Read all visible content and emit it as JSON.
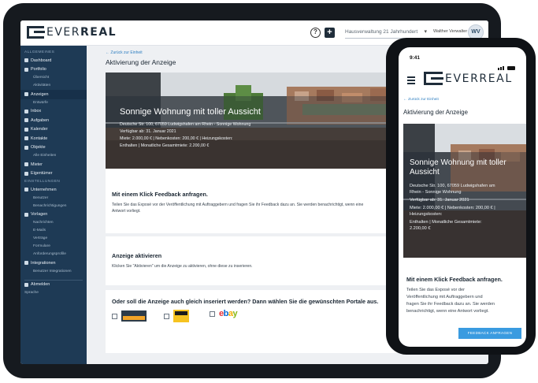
{
  "brand": {
    "name": "EVERREAL",
    "name_light": "EVER",
    "name_bold": "REAL"
  },
  "topbar": {
    "select_value": "Hausverwaltung 21 Jahrhundert",
    "user_name": "Walther Verwalter",
    "avatar_initials": "WV"
  },
  "sidebar": {
    "sections": [
      {
        "heading": "ALLGEMEINES",
        "items": [
          {
            "label": "Dashboard",
            "icon": "grid-icon"
          },
          {
            "label": "Portfolio",
            "icon": "pin-icon",
            "subitems": [
              "Übersicht",
              "Aktivitäten"
            ]
          },
          {
            "label": "Anzeigen",
            "icon": "list-icon",
            "subitems": [
              "Entwürfe"
            ]
          },
          {
            "label": "Inbox",
            "icon": "inbox-icon"
          },
          {
            "label": "Aufgaben",
            "icon": "task-icon"
          },
          {
            "label": "Kalender",
            "icon": "calendar-icon"
          },
          {
            "label": "Kontakte",
            "icon": "contacts-icon"
          },
          {
            "label": "Objekte",
            "icon": "objects-icon",
            "subitems": [
              "Alle Einheiten"
            ]
          },
          {
            "label": "Mieter",
            "icon": "tenant-icon"
          },
          {
            "label": "Eigentümer",
            "icon": "owner-icon"
          }
        ]
      },
      {
        "heading": "EINSTELLUNGEN",
        "items": [
          {
            "label": "Unternehmen",
            "icon": "company-icon",
            "subitems": [
              "Benutzer",
              "Benachrichtigungen"
            ]
          },
          {
            "label": "Vorlagen",
            "icon": "template-icon",
            "subitems": [
              "Nachrichten",
              "E-Mails",
              "Verträge",
              "Formulare",
              "Anforderungsprofile"
            ]
          },
          {
            "label": "Integrationen",
            "icon": "integration-icon",
            "subitems": [
              "Benutzer Integrationen"
            ]
          }
        ]
      }
    ],
    "logout_label": "Abmelden",
    "language_label": "Sprache"
  },
  "main": {
    "back_label": "Zurück zur Einheit",
    "title": "Aktivierung der Anzeige",
    "hero": {
      "title": "Sonnige Wohnung mit toller Aussicht",
      "lines": [
        "Deutsche Str. 100, 67059 Ludwigshafen am Rhein - Sonnige Wohnung",
        "Verfügbar ab: 31. Januar 2021",
        "Miete: 2.000,00 € | Nebenkosten: 200,00 € | Heizungskosten:",
        "Enthalten | Monatliche Gesamtmiete: 2.200,00 €"
      ]
    },
    "feedback": {
      "title": "Mit einem Klick Feedback anfragen.",
      "text_1": "Teilen Sie das Exposé vor der Veröffentlichung mit Auftraggebern und fragen Sie ihr Feedback dazu an. Sie werden benachrichtigt, wenn eine",
      "text_2": "Antwort vorliegt."
    },
    "activate": {
      "title": "Anzeige aktivieren",
      "text": "Klicken Sie \"Aktivieren\" um die Anzeige zu aktivieren, ohne diese zu inserieren."
    },
    "portals": {
      "title": "Oder soll die Anzeige auch gleich inseriert werden? Dann wählen Sie die gewünschten Portale aus.",
      "items": [
        {
          "name": "ImmobilienScout24",
          "logo_text": "IMMOBILIEN SCOUT24"
        },
        {
          "name": "Immowelt",
          "logo_text": "immo welt"
        },
        {
          "name": "eBay",
          "logo_text": "ebay"
        }
      ]
    }
  },
  "phone": {
    "time": "9:41",
    "back_label": "Zurück zur Einheit",
    "title": "Aktivierung der Anzeige",
    "hero_title_1": "Sonnige Wohnung mit toller",
    "hero_title_2": "Aussicht",
    "hero_lines": [
      "Deutsche Str. 100, 67059 Ludwigshafen am",
      "Rhein - Sonnige Wohnung",
      "Verfügbar ab: 31. Januar 2021",
      "Miete: 2.000,00 € | Nebenkosten: 200,00 € |",
      "Heizungskosten:",
      "Enthalten | Monatliche Gesamtmiete:",
      "2.200,00 €"
    ],
    "card_title": "Mit einem Klick Feedback anfragen.",
    "card_lines": [
      "Teilen Sie das Exposé vor der",
      "Veröffentlichung mit Auftraggebern und",
      "fragen Sie ihr Feedback dazu an. Sie werden",
      "benachrichtigt, wenn eine Antwort vorliegt."
    ],
    "button_label": "FEEDBACK ANFRAGEN"
  },
  "colors": {
    "sidebar": "#1e3a55",
    "accent": "#3a9be0",
    "link": "#2f7fc1",
    "device_frame": "#161a1f"
  }
}
